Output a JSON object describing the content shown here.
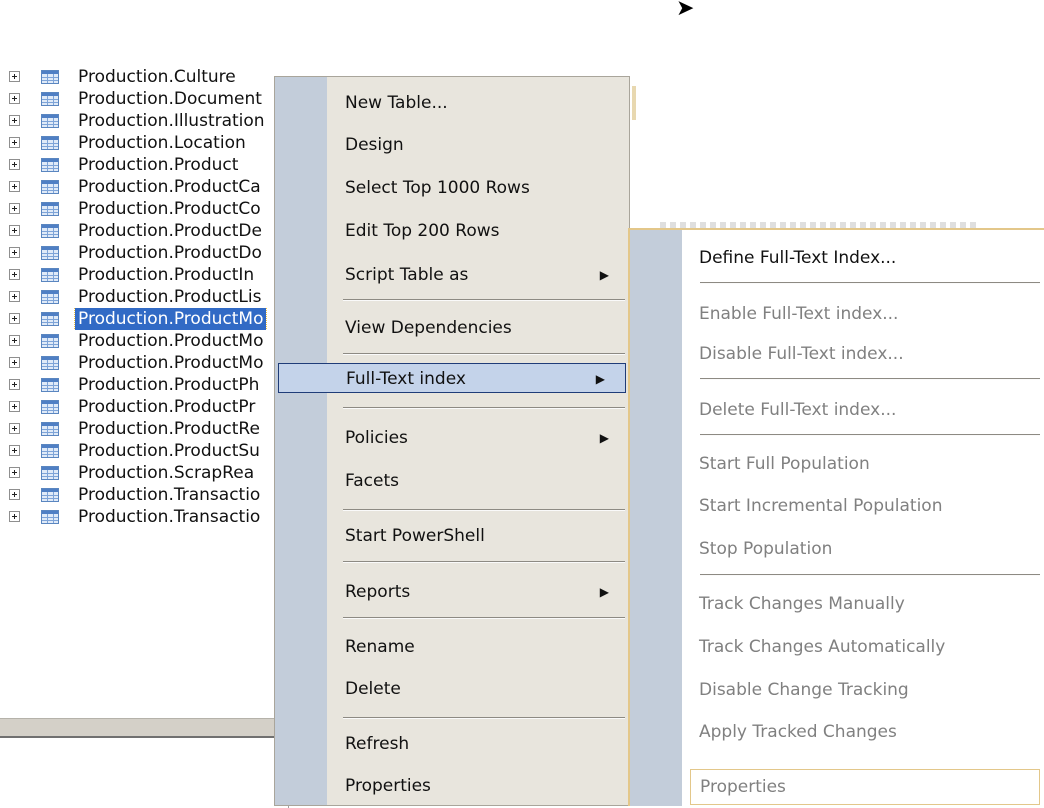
{
  "tree": {
    "items": [
      {
        "label": "Production.Culture"
      },
      {
        "label": "Production.Document"
      },
      {
        "label": "Production.Illustration"
      },
      {
        "label": "Production.Location"
      },
      {
        "label": "Production.Product"
      },
      {
        "label": "Production.ProductCa"
      },
      {
        "label": "Production.ProductCo"
      },
      {
        "label": "Production.ProductDe"
      },
      {
        "label": "Production.ProductDo"
      },
      {
        "label": "Production.ProductIn"
      },
      {
        "label": "Production.ProductLis"
      },
      {
        "label": "Production.ProductMo",
        "selected": true
      },
      {
        "label": "Production.ProductMo"
      },
      {
        "label": "Production.ProductMo"
      },
      {
        "label": "Production.ProductPh"
      },
      {
        "label": "Production.ProductPr"
      },
      {
        "label": "Production.ProductRe"
      },
      {
        "label": "Production.ProductSu"
      },
      {
        "label": "Production.ScrapRea"
      },
      {
        "label": "Production.Transactio"
      },
      {
        "label": "Production.Transactio"
      }
    ]
  },
  "context_menu": {
    "items": {
      "new_table": "New Table...",
      "design": "Design",
      "select_top": "Select Top 1000 Rows",
      "edit_top": "Edit Top 200 Rows",
      "script_table_as": "Script Table as",
      "view_dependencies": "View Dependencies",
      "full_text_index": "Full-Text index",
      "policies": "Policies",
      "facets": "Facets",
      "start_powershell": "Start PowerShell",
      "reports": "Reports",
      "rename": "Rename",
      "delete": "Delete",
      "refresh": "Refresh",
      "properties": "Properties"
    },
    "hovered": "Full-Text index"
  },
  "submenu": {
    "items": {
      "define": "Define Full-Text Index...",
      "enable": "Enable Full-Text index...",
      "disable": "Disable Full-Text index...",
      "delete": "Delete Full-Text index...",
      "start_full": "Start Full Population",
      "start_incremental": "Start Incremental Population",
      "stop": "Stop Population",
      "track_manual": "Track Changes Manually",
      "track_auto": "Track Changes Automatically",
      "disable_tracking": "Disable Change Tracking",
      "apply_tracked": "Apply Tracked Changes",
      "properties": "Properties"
    }
  },
  "icons": {
    "cursor": "arrow-cursor-icon",
    "expander": "plus-expander-icon",
    "table": "table-icon",
    "submenu_arrow": "triangle-right-icon"
  },
  "colors": {
    "selection": "#316ac5",
    "menu_bg": "#e8e5dd",
    "menu_gutter": "#c3cdda",
    "hover_bg": "#c4d3ea",
    "hover_border": "#1f3c78",
    "disabled_text": "#808080"
  }
}
